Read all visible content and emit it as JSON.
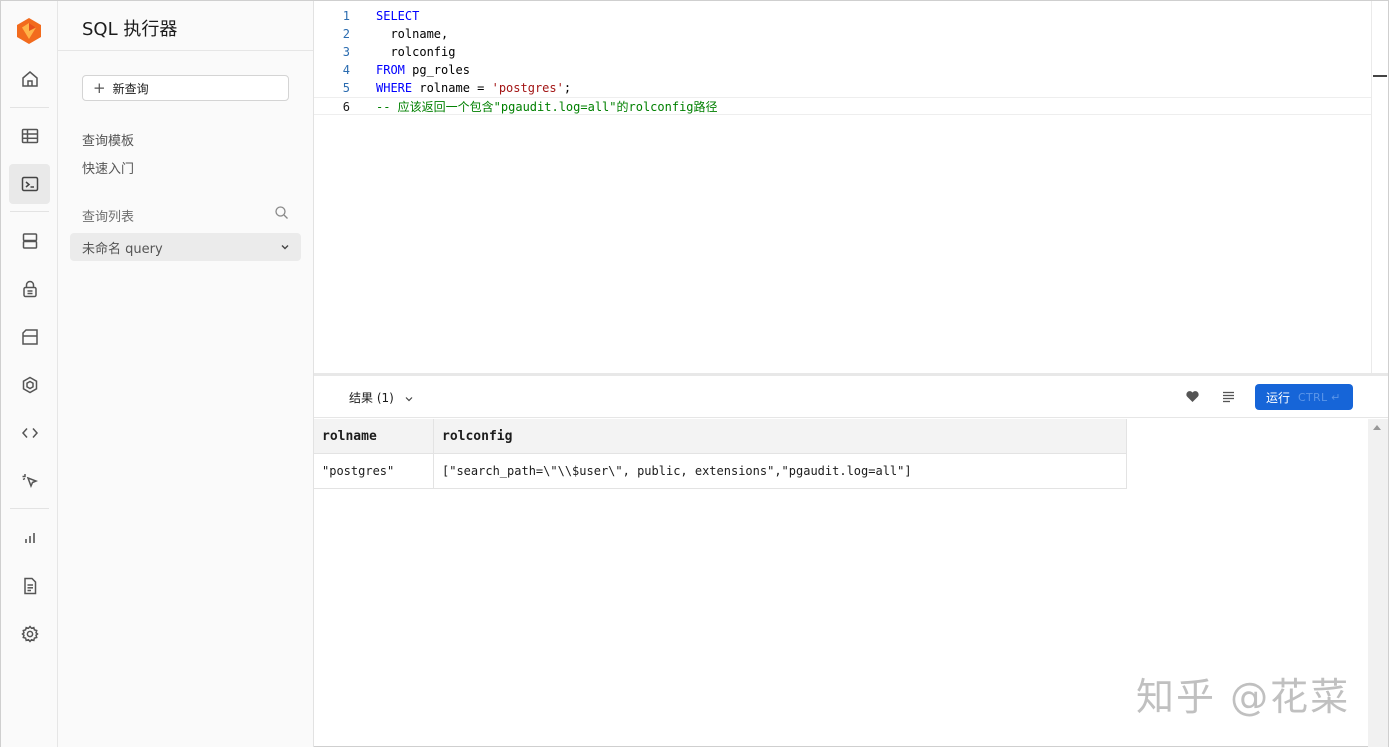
{
  "rail": {
    "icons": [
      "home-icon",
      "table-editor-icon",
      "sql-editor-icon",
      "database-icon",
      "auth-lock-icon",
      "storage-icon",
      "edge-functions-icon",
      "api-code-icon",
      "realtime-pointer-icon",
      "reports-chart-icon",
      "logs-document-icon",
      "settings-gear-icon"
    ]
  },
  "sidebar": {
    "title": "SQL 执行器",
    "new_query": "新查询",
    "templates": "查询模板",
    "quickstart": "快速入门",
    "list_header": "查询列表",
    "query_item": "未命名 query"
  },
  "editor": {
    "lines": [
      {
        "num": "1",
        "parts": [
          {
            "t": "SELECT",
            "c": "kw"
          }
        ]
      },
      {
        "num": "2",
        "parts": [
          {
            "t": "  rolname,",
            "c": ""
          }
        ]
      },
      {
        "num": "3",
        "parts": [
          {
            "t": "  rolconfig",
            "c": ""
          }
        ]
      },
      {
        "num": "4",
        "parts": [
          {
            "t": "FROM",
            "c": "kw"
          },
          {
            "t": " pg_roles",
            "c": ""
          }
        ]
      },
      {
        "num": "5",
        "parts": [
          {
            "t": "WHERE",
            "c": "kw"
          },
          {
            "t": " rolname = ",
            "c": ""
          },
          {
            "t": "'postgres'",
            "c": "str"
          },
          {
            "t": ";",
            "c": ""
          }
        ]
      },
      {
        "num": "6",
        "parts": [
          {
            "t": "-- 应该返回一个包含\"pgaudit.log=all\"的rolconfig路径",
            "c": "cmt"
          }
        ]
      }
    ]
  },
  "results": {
    "tab_label": "结果 (1)",
    "run_label": "运行",
    "run_shortcut": "CTRL ↵",
    "columns": [
      "rolname",
      "rolconfig"
    ],
    "rows": [
      [
        "\"postgres\"",
        "[\"search_path=\\\"\\\\$user\\\", public, extensions\",\"pgaudit.log=all\"]"
      ]
    ]
  },
  "watermark": "知乎 @花菜",
  "colors": {
    "accent": "#1665d8",
    "keyword": "#0000ff",
    "string": "#a31515",
    "comment": "#008000",
    "logo": "#f26b1d"
  }
}
